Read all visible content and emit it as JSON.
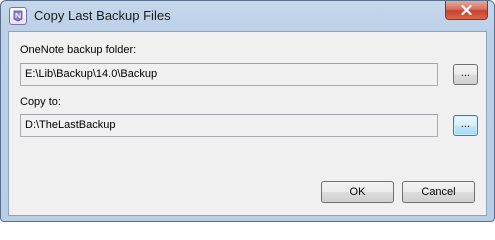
{
  "window": {
    "title": "Copy Last Backup Files",
    "icon": "onenote-icon",
    "close_icon": "close-icon"
  },
  "backup_folder": {
    "label": "OneNote backup folder:",
    "value": "E:\\Lib\\Backup\\14.0\\Backup",
    "browse_label": "..."
  },
  "copy_to": {
    "label": "Copy to:",
    "value": "D:\\TheLastBackup",
    "browse_label": "..."
  },
  "buttons": {
    "ok_label": "OK",
    "cancel_label": "Cancel"
  }
}
